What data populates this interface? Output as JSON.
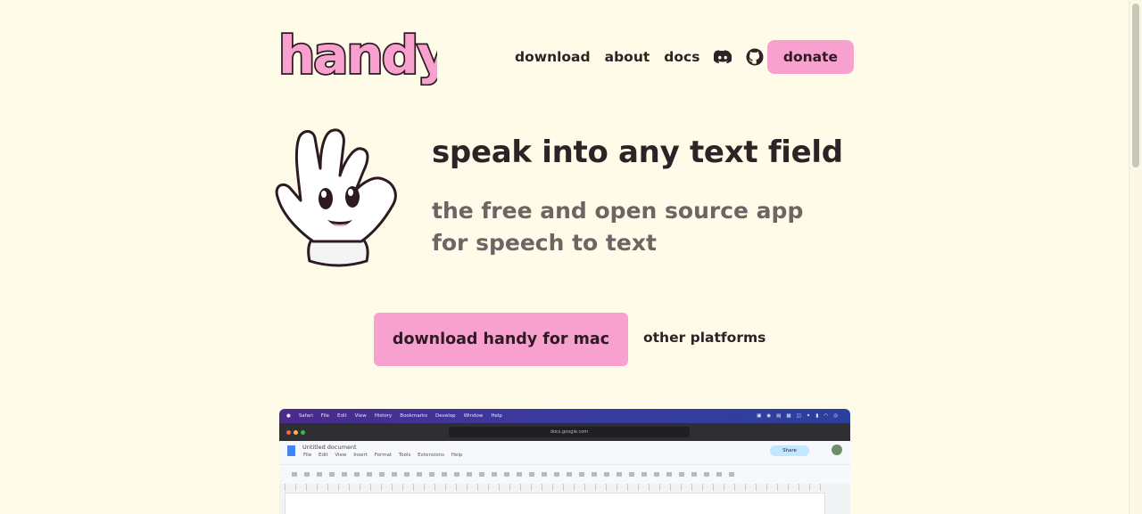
{
  "brand": {
    "name": "handy"
  },
  "nav": {
    "items": [
      "download",
      "about",
      "docs"
    ],
    "icons": [
      "discord-icon",
      "github-icon"
    ],
    "donate": "donate"
  },
  "hero": {
    "headline": "speak into any text field",
    "subline": "the free and open source app for speech to text"
  },
  "cta": {
    "primary": "download handy for mac",
    "secondary": "other platforms"
  },
  "colors": {
    "background": "#fefce8",
    "accent_pink": "#f8a1cf",
    "text_dark": "#2d2326",
    "text_muted": "#6e6463"
  },
  "screenshot": {
    "mac_menu": [
      "Safari",
      "File",
      "Edit",
      "View",
      "History",
      "Bookmarks",
      "Develop",
      "Window",
      "Help"
    ],
    "url": "docs.google.com",
    "doc_title": "Untitled document",
    "doc_menu": [
      "File",
      "Edit",
      "View",
      "Insert",
      "Format",
      "Tools",
      "Extensions",
      "Help"
    ],
    "share_label": "Share"
  }
}
